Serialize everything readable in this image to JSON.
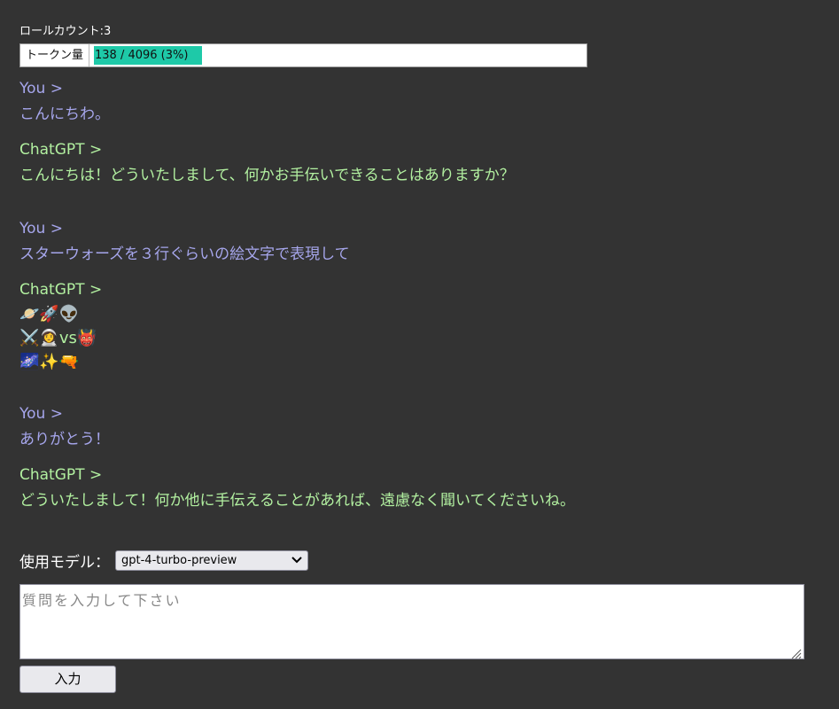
{
  "header": {
    "role_count": "ロールカウント:3"
  },
  "tokens": {
    "label": "トークン量",
    "text": "138 / 4096 (3%)",
    "used": 138,
    "max": 4096,
    "fill_color": "#1ec9a8"
  },
  "messages": [
    {
      "role": "you",
      "speaker": "You >",
      "lines": [
        "こんにちわ。"
      ]
    },
    {
      "role": "gpt",
      "speaker": "ChatGPT >",
      "lines": [
        "こんにちは！どういたしまして、何かお手伝いできることはありますか？"
      ]
    },
    {
      "role": "you",
      "speaker": "You >",
      "lines": [
        "スターウォーズを３行ぐらいの絵文字で表現して"
      ]
    },
    {
      "role": "gpt",
      "speaker": "ChatGPT >",
      "lines": [
        "🪐🚀👽",
        "⚔️👩‍🚀vs👹",
        "🌌✨🔫"
      ]
    },
    {
      "role": "you",
      "speaker": "You >",
      "lines": [
        "ありがとう！"
      ]
    },
    {
      "role": "gpt",
      "speaker": "ChatGPT >",
      "lines": [
        "どういたしまして！何か他に手伝えることがあれば、遠慮なく聞いてくださいね。"
      ]
    }
  ],
  "model": {
    "label": "使用モデル：",
    "selected": "gpt-4-turbo-preview"
  },
  "input": {
    "placeholder": "質問を入力して下さい",
    "submit_label": "入力"
  },
  "colors": {
    "background": "#333333",
    "user_text": "#a6a6ec",
    "assistant_text": "#b2f0a0"
  }
}
